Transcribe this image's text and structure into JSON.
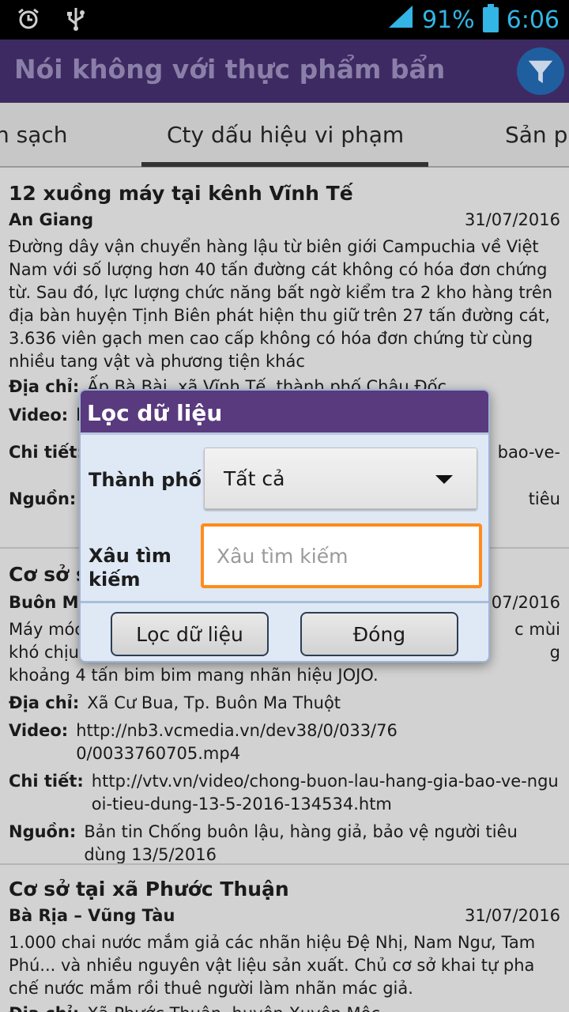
{
  "status_bar": {
    "battery": "91%",
    "time": "6:06",
    "icons": [
      "alarm-icon",
      "usb-icon",
      "signal-icon",
      "battery-charging-icon"
    ]
  },
  "app": {
    "title": "Nói không với thực phẩm bẩn",
    "filter_icon": "filter-icon"
  },
  "tabs": [
    {
      "label": "n sạch"
    },
    {
      "label": "Cty dấu hiệu vi phạm",
      "active": true
    },
    {
      "label": "Sản p"
    }
  ],
  "items": [
    {
      "title": "12 xuồng máy tại kênh Vĩnh Tế",
      "location": "An Giang",
      "date": "31/07/2016",
      "description": "Đường dây vận chuyển hàng lậu từ biên giới Campuchia về Việt Nam với số lượng hơn 40 tấn đường cát không có hóa đơn chứng từ. Sau đó, lực lượng chức năng bất ngờ kiểm tra 2 kho hàng trên địa bàn huyện Tịnh Biên phát hiện thu giữ trên 27 tấn đường cát, 3.636 viên gạch men cao cấp không có hóa đơn chứng từ cùng nhiều tang vật và phương tiện khác",
      "address_label": "Địa chỉ:",
      "address": "Ấp Bà Bài, xã Vĩnh Tế, thành phố Châu Đốc",
      "video_label": "Video:",
      "video": "h",
      "detail_label": "Chi tiết:",
      "detail": "bao-ve-",
      "source_label": "Nguồn:",
      "source": "tiêu"
    },
    {
      "title": "Cơ sở s",
      "location": "Buôn Ma",
      "date": "07/2016",
      "description_lines": [
        "Máy móc",
        "c mùi",
        "khó chịu",
        "g",
        "khoảng 4 tấn bim bim mang nhãn hiệu JOJO."
      ],
      "address_label": "Địa chỉ:",
      "address": "Xã Cư Bua, Tp. Buôn Ma Thuột",
      "video_label": "Video:",
      "video": "http://nb3.vcmedia.vn/dev38/0/033/760/0033760705.mp4",
      "detail_label": "Chi tiết:",
      "detail": "http://vtv.vn/video/chong-buon-lau-hang-gia-bao-ve-nguoi-tieu-dung-13-5-2016-134534.htm",
      "source_label": "Nguồn:",
      "source": "Bản tin Chống buôn lậu, hàng giả, bảo vệ người tiêu dùng 13/5/2016"
    },
    {
      "title": "Cơ sở tại xã Phước Thuận",
      "location": "Bà Rịa – Vũng Tàu",
      "date": "31/07/2016",
      "description": "1.000 chai nước mắm giả các nhãn hiệu Đệ Nhị, Nam Ngư, Tam Phú... và nhiều nguyên vật liệu sản xuất. Chủ cơ sở khai tự pha chế nước mắm rồi thuê người làm nhãn mác giả.",
      "address_label": "Địa chỉ:",
      "address": "Xã Phước Thuận, huyện Xuyên Mộc"
    }
  ],
  "dialog": {
    "title": "Lọc dữ liệu",
    "city_label": "Thành phố",
    "city_value": "Tất cả",
    "search_label_line1": "Xâu tìm",
    "search_label_line2": "kiếm",
    "search_placeholder": "Xâu tìm kiếm",
    "search_value": "",
    "filter_button": "Lọc dữ liệu",
    "close_button": "Đóng",
    "accent": "#ff8c1a",
    "header_color": "#5a3a7e"
  }
}
